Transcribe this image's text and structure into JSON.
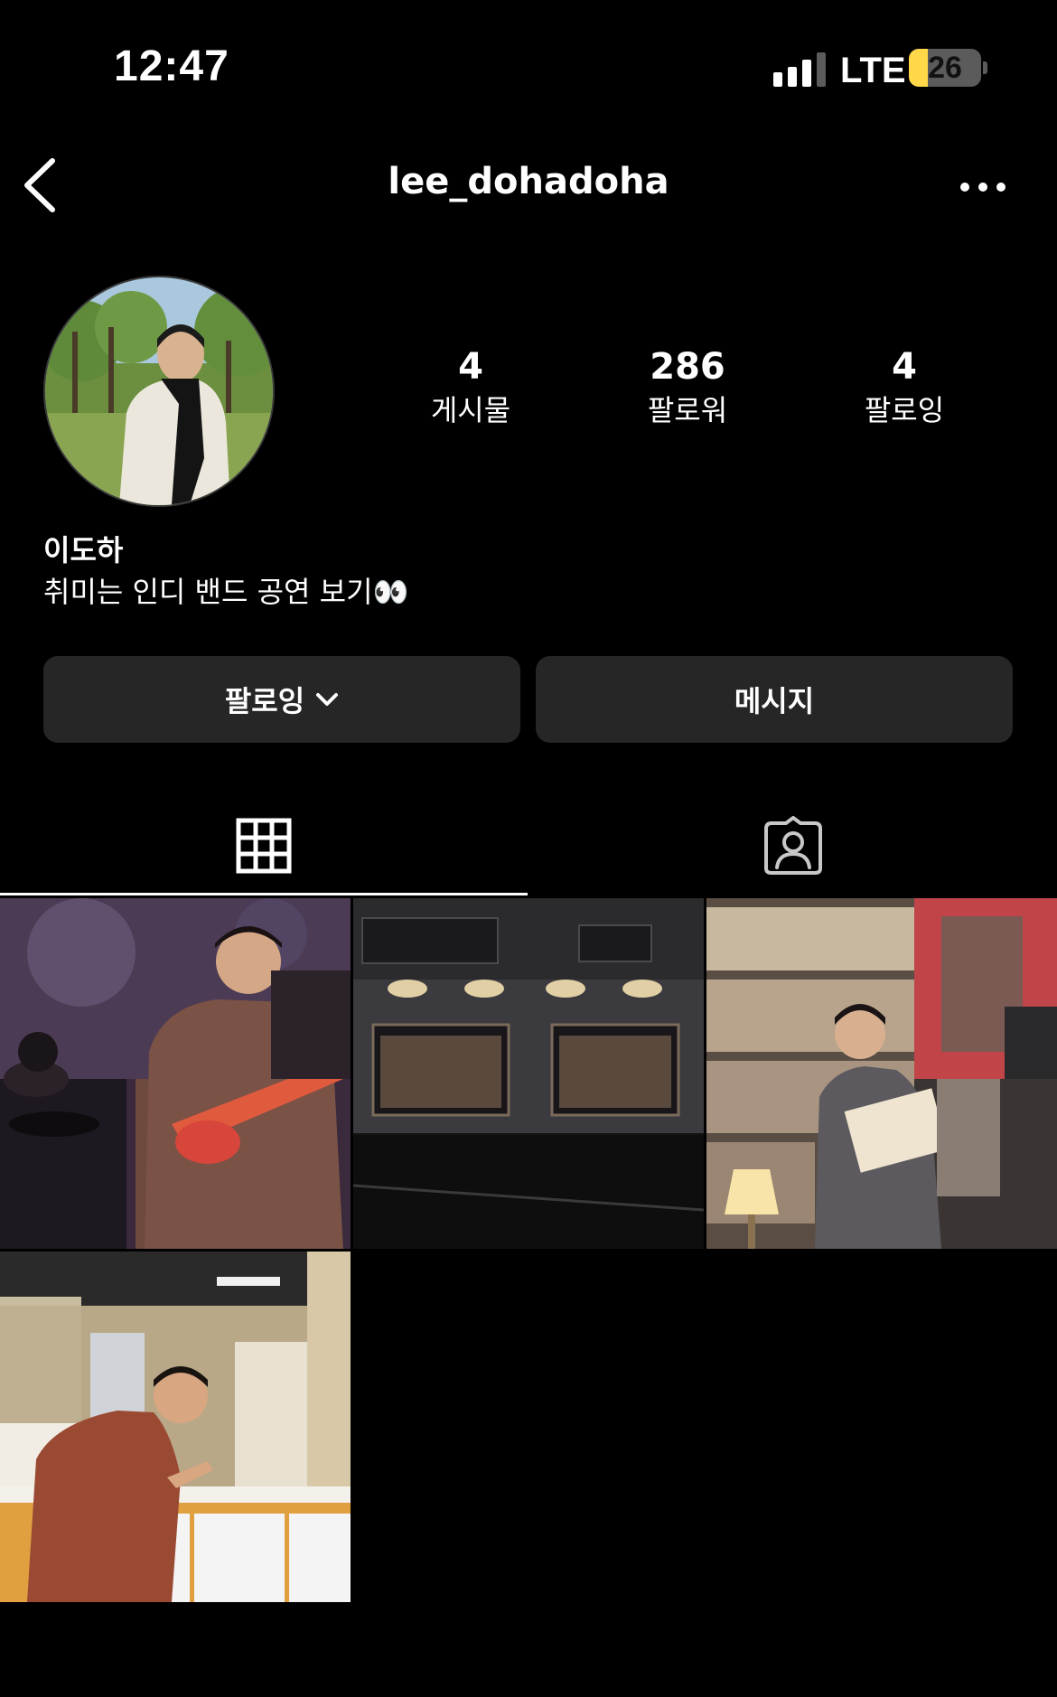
{
  "status_bar": {
    "time": "12:47",
    "network": "LTE",
    "battery_level": "26",
    "battery_fraction": 0.26,
    "signal_bars_active": 3,
    "signal_bars_total": 4
  },
  "header": {
    "username": "lee_dohadoha",
    "back_icon": "chevron-left-icon",
    "more_icon": "more-horizontal-icon"
  },
  "profile": {
    "stats": [
      {
        "value": "4",
        "label": "게시물"
      },
      {
        "value": "286",
        "label": "팔로워"
      },
      {
        "value": "4",
        "label": "팔로잉"
      }
    ],
    "name": "이도하",
    "bio": "취미는 인디 밴드 공연 보기👀"
  },
  "actions": {
    "following_label": "팔로잉",
    "message_label": "메시지"
  },
  "tabs": [
    {
      "icon": "grid-icon",
      "active": true
    },
    {
      "icon": "tagged-icon",
      "active": false
    }
  ],
  "posts": [
    {
      "icon": "post-band-guitarist-image"
    },
    {
      "icon": "post-building-night-image"
    },
    {
      "icon": "post-record-store-reading-image"
    },
    {
      "icon": "post-cafe-counter-image"
    }
  ],
  "colors": {
    "background": "#000000",
    "button": "#262626",
    "battery": "#ffd84a"
  }
}
